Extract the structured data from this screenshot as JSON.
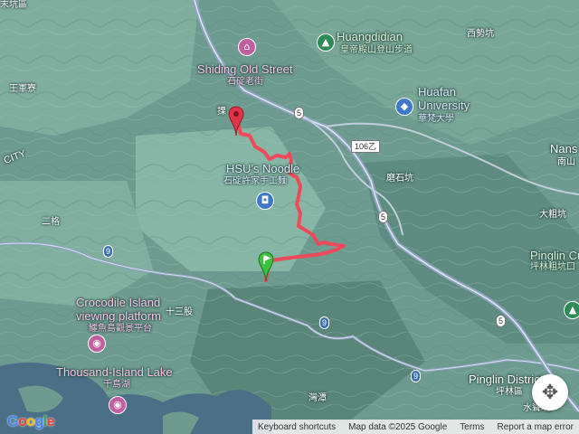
{
  "labels": {
    "shiding_old_street": "Shiding Old Street",
    "shiding_old_street_zh": "石碇老街",
    "huangdidian": "Huangdidian",
    "huangdidian_zh": "皇帝殿山登山步道",
    "huafan_university_1": "Huafan",
    "huafan_university_2": "University",
    "huafan_university_zh": "華梵大學",
    "hsus_noodle": "HSU's Noodle",
    "hsus_noodle_zh": "石碇許家手工麵",
    "crocodile_island_1": "Crocodile Island",
    "crocodile_island_2": "viewing platform",
    "crocodile_island_zh": "鱷魚島觀景平台",
    "thousand_island_lake": "Thousand-Island Lake",
    "thousand_island_lake_zh": "千島湖",
    "pinglin_cuken": "Pinglin Cuken",
    "pinglin_cuken_zh": "坪林粗坑口",
    "pinglin_district": "Pinglin District",
    "pinglin_district_zh": "坪林區",
    "nans": "Nans",
    "nans_zh": "南山",
    "top_left_area": "末坑區",
    "wangjia": "王軍寮",
    "city": "CITY",
    "erge": "二格",
    "shisangu": "十三股",
    "xishikeng": "西勢坑",
    "moshikeng": "磨石坑",
    "dacukeng": "大粗坑",
    "zhanlantan": "灣潭",
    "shuidengkeng": "水聳坑",
    "start_road_label": "搮",
    "road_106": "106乙",
    "road_5a": "5",
    "road_5b": "5",
    "road_5c": "5",
    "road_9a": "9",
    "road_9b": "9",
    "road_9c": "9"
  },
  "attribution": {
    "keyboard_shortcuts": "Keyboard shortcuts",
    "map_data": "Map data ©2025 Google",
    "terms": "Terms",
    "report": "Report a map error"
  },
  "logo": [
    "G",
    "o",
    "o",
    "g",
    "l",
    "e"
  ],
  "colors": {
    "route": "#ef4a5a",
    "start_marker": "#3cc23e",
    "end_marker": "#e2334a",
    "poi_pink": "#c05ea0",
    "poi_blue": "#3f78c8",
    "poi_green": "#2e8b57",
    "water": "#4a6f86",
    "terrain": "#6d9b8f",
    "road": "#8fa3c0"
  },
  "icons": {
    "start": "green-flag-marker",
    "end": "red-pin-marker",
    "recenter": "recenter-icon"
  }
}
